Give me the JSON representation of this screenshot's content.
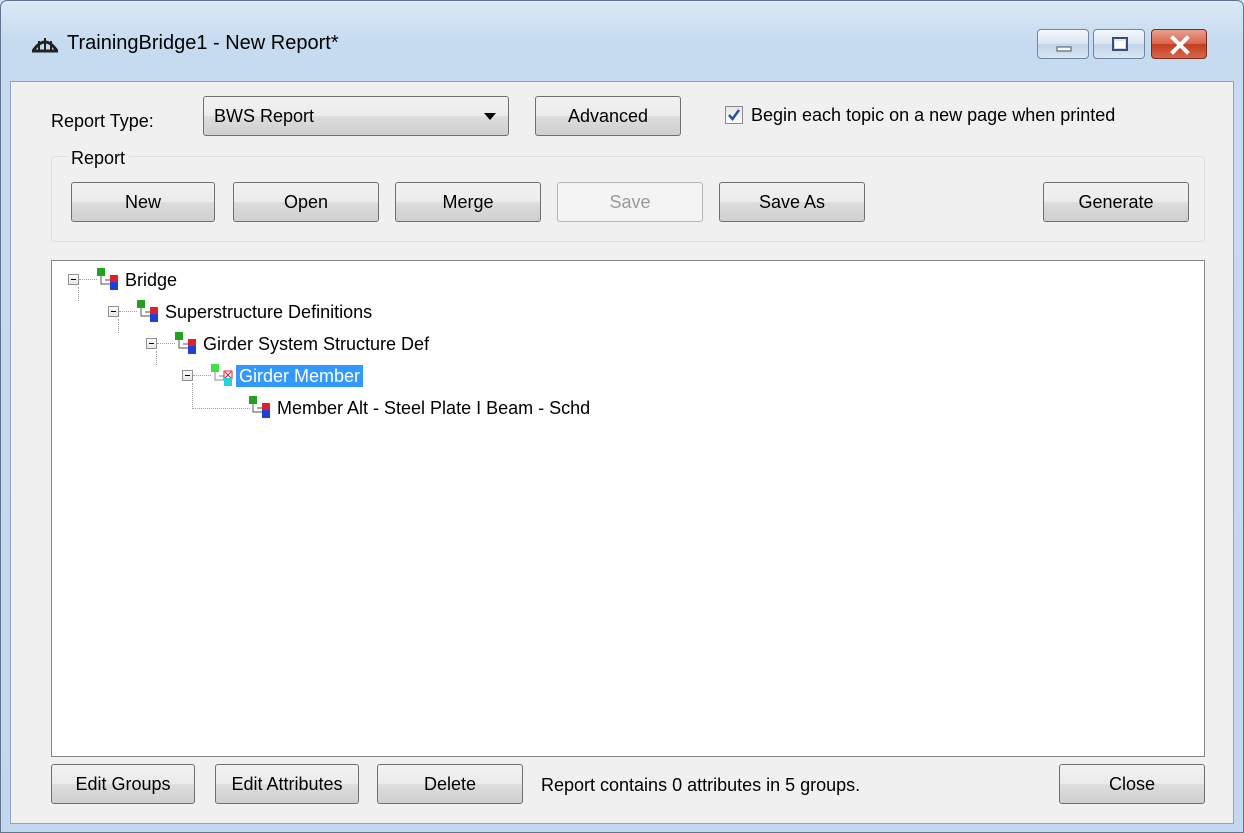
{
  "window": {
    "title": "TrainingBridge1 - New Report*"
  },
  "top": {
    "report_type_label": "Report Type:",
    "report_type_value": "BWS Report",
    "advanced_label": "Advanced",
    "checkbox_label": "Begin each topic on a new page when printed",
    "checkbox_checked": true
  },
  "report_group": {
    "label": "Report",
    "buttons": {
      "new": "New",
      "open": "Open",
      "merge": "Merge",
      "save": "Save",
      "save_as": "Save As",
      "generate": "Generate"
    }
  },
  "tree": {
    "nodes": [
      {
        "label": "Bridge",
        "depth": 0,
        "selected": false
      },
      {
        "label": "Superstructure Definitions",
        "depth": 1,
        "selected": false
      },
      {
        "label": "Girder System Structure Def",
        "depth": 2,
        "selected": false
      },
      {
        "label": "Girder Member",
        "depth": 3,
        "selected": true
      },
      {
        "label": "Member Alt - Steel Plate I Beam - Schd",
        "depth": 4,
        "selected": false
      }
    ]
  },
  "bottom": {
    "edit_groups": "Edit Groups",
    "edit_attributes": "Edit Attributes",
    "delete": "Delete",
    "status_text": "Report contains 0 attributes in 5 groups.",
    "close": "Close"
  },
  "colors": {
    "selection": "#3399ff",
    "close_button": "#c9462a",
    "icon_green": "#1fa31f",
    "icon_red": "#e0202a",
    "icon_blue": "#1f3fd6",
    "icon_cyan": "#22d3e0"
  }
}
